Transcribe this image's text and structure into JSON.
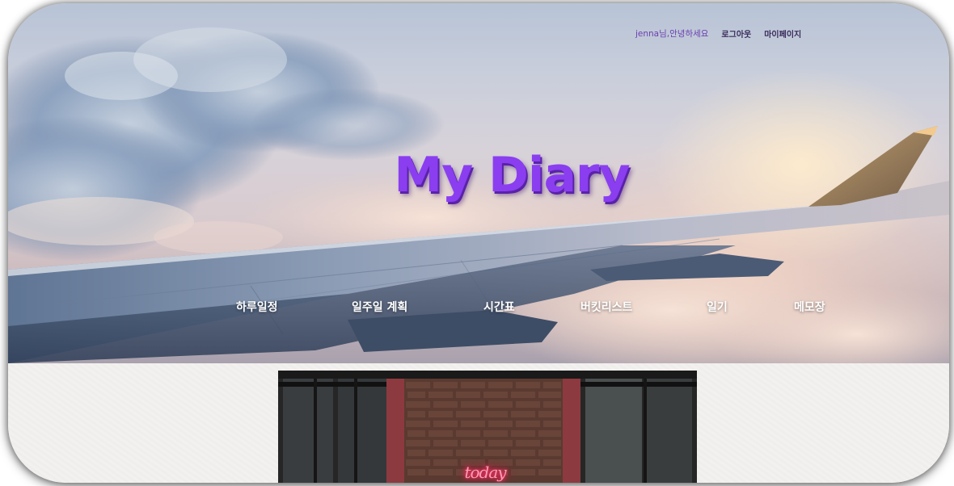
{
  "header": {
    "greeting": "jenna님,안녕하세요",
    "logout_label": "로그아웃",
    "mypage_label": "마이페이지"
  },
  "hero": {
    "title": "My Diary"
  },
  "nav": {
    "items": [
      {
        "label": "하루일정"
      },
      {
        "label": "일주일 계획"
      },
      {
        "label": "시간표"
      },
      {
        "label": "버킷리스트"
      },
      {
        "label": "일기"
      },
      {
        "label": "메모장"
      }
    ]
  },
  "feature": {
    "neon_text": "today"
  },
  "colors": {
    "title": "#8a3ef0",
    "greeting": "#6b3fb0",
    "nav_text": "#ffffff"
  }
}
